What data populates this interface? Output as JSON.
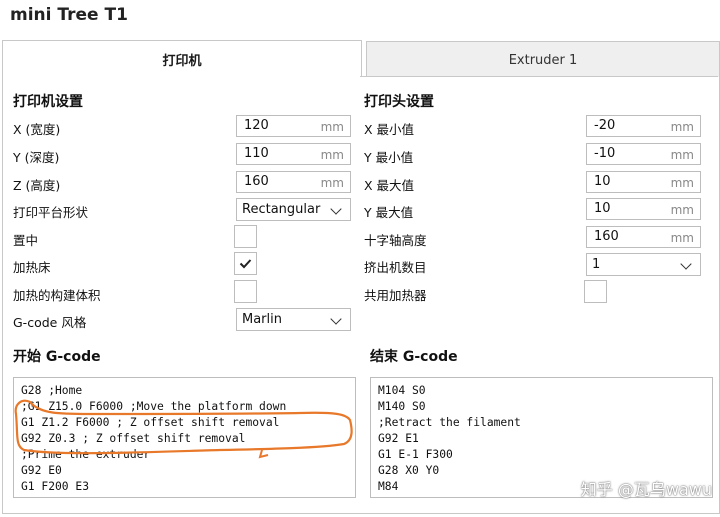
{
  "window": {
    "title": "mini Tree T1"
  },
  "tabs": [
    {
      "label": "打印机",
      "active": true
    },
    {
      "label": "Extruder 1",
      "active": false
    }
  ],
  "printer_settings": {
    "heading": "打印机设置",
    "width": {
      "label": "X (宽度)",
      "value": "120",
      "unit": "mm"
    },
    "depth": {
      "label": "Y (深度)",
      "value": "110",
      "unit": "mm"
    },
    "height": {
      "label": "Z (高度)",
      "value": "160",
      "unit": "mm"
    },
    "bed_shape": {
      "label": "打印平台形状",
      "value": "Rectangular"
    },
    "center": {
      "label": "置中",
      "checked": false
    },
    "heated_bed": {
      "label": "加热床",
      "checked": true
    },
    "heated_volume": {
      "label": "加热的构建体积",
      "checked": false
    },
    "gcode_flavor": {
      "label": "G-code 风格",
      "value": "Marlin"
    }
  },
  "printhead_settings": {
    "heading": "打印头设置",
    "x_min": {
      "label": "X 最小值",
      "value": "-20",
      "unit": "mm"
    },
    "y_min": {
      "label": "Y 最小值",
      "value": "-10",
      "unit": "mm"
    },
    "x_max": {
      "label": "X 最大值",
      "value": "10",
      "unit": "mm"
    },
    "y_max": {
      "label": "Y 最大值",
      "value": "10",
      "unit": "mm"
    },
    "gantry_height": {
      "label": "十字轴高度",
      "value": "160",
      "unit": "mm"
    },
    "extruder_count": {
      "label": "挤出机数目",
      "value": "1"
    },
    "shared_heater": {
      "label": "共用加热器",
      "checked": false
    }
  },
  "start_gcode": {
    "heading": "开始 G-code",
    "lines": [
      "G28 ;Home",
      ";G1 Z15.0 F6000 ;Move the platform down",
      "G1 Z1.2 F6000 ; Z offset shift removal",
      "G92 Z0.3 ; Z offset shift removal",
      ";Prime the extruder",
      "G92 E0",
      "G1 F200 E3"
    ]
  },
  "end_gcode": {
    "heading": "结束 G-code",
    "lines": [
      "M104 S0",
      "M140 S0",
      ";Retract the filament",
      "G92 E1",
      "G1 E-1 F300",
      "G28 X0 Y0",
      "M84"
    ]
  },
  "watermark": {
    "text": "知乎 @瓦乌wawu"
  },
  "colors": {
    "annotation": "#e8782a",
    "border": "#bdbdbd",
    "inactive_tab": "#efefef"
  }
}
